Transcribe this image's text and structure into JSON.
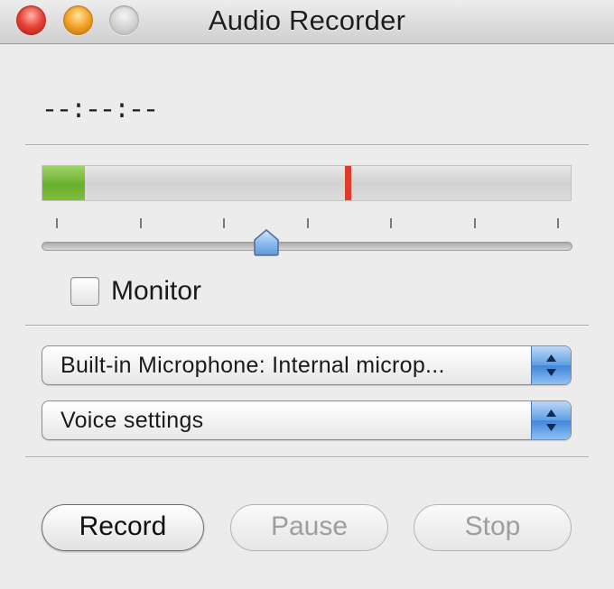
{
  "window": {
    "title": "Audio Recorder",
    "close_button_color": "#e8453a",
    "minimize_button_color": "#f4a62a",
    "zoom_button_color": "#c8c8c8"
  },
  "time_display": "--:--:--",
  "level_meter": {
    "level_fraction": 0.08,
    "peak_fraction": 0.57,
    "level_color": "#6aae2c",
    "peak_color": "#e03a2b"
  },
  "volume_slider": {
    "value_fraction": 0.42,
    "tick_count": 7
  },
  "monitor": {
    "label": "Monitor",
    "checked": false
  },
  "input_source": {
    "selected": "Built-in Microphone: Internal microp..."
  },
  "quality": {
    "selected": "Voice settings"
  },
  "buttons": {
    "record": "Record",
    "pause": "Pause",
    "stop": "Stop"
  }
}
